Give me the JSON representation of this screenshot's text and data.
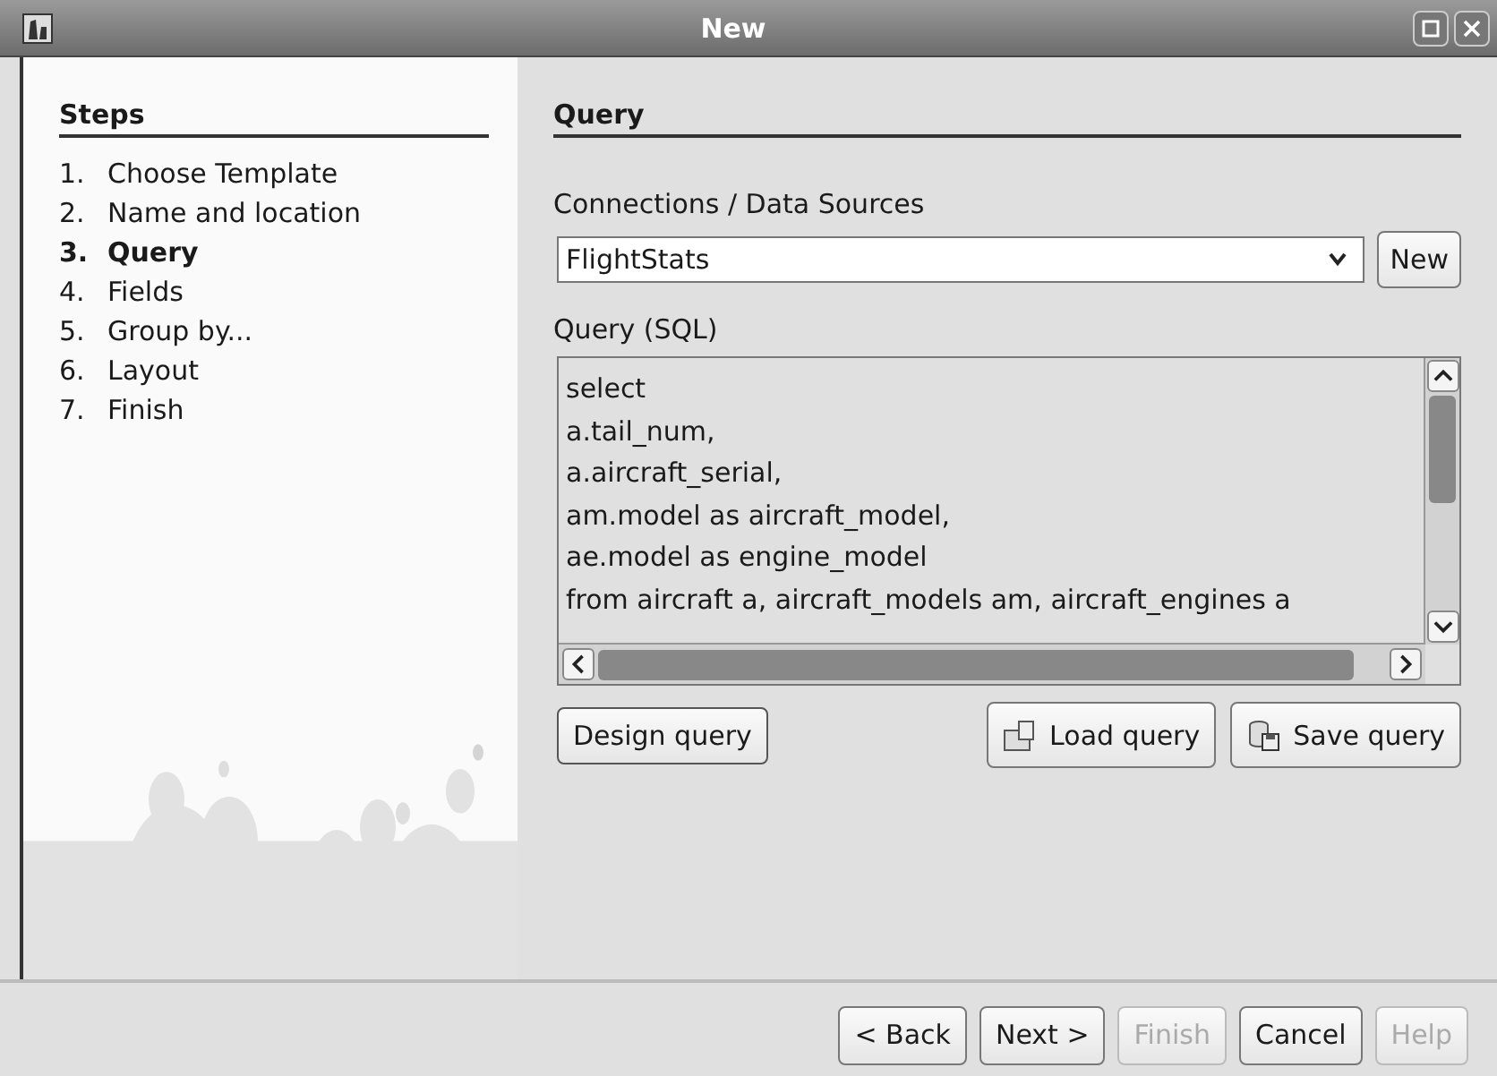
{
  "window": {
    "title": "New"
  },
  "steps": {
    "heading": "Steps",
    "items": [
      {
        "number": "1.",
        "label": "Choose Template",
        "selected": false
      },
      {
        "number": "2.",
        "label": "Name and location",
        "selected": false
      },
      {
        "number": "3.",
        "label": "Query",
        "selected": true
      },
      {
        "number": "4.",
        "label": "Fields",
        "selected": false
      },
      {
        "number": "5.",
        "label": "Group by...",
        "selected": false
      },
      {
        "number": "6.",
        "label": "Layout",
        "selected": false
      },
      {
        "number": "7.",
        "label": "Finish",
        "selected": false
      }
    ]
  },
  "page": {
    "heading": "Query",
    "connections_label": "Connections / Data Sources",
    "connection": {
      "value": "FlightStats"
    },
    "new_button": "New",
    "query_label": "Query (SQL)",
    "query_lines": [
      "select",
      "a.tail_num,",
      "a.aircraft_serial,",
      "am.model as aircraft_model,",
      "ae.model as engine_model",
      "from aircraft a, aircraft_models am, aircraft_engines a"
    ],
    "actions": [
      {
        "label": "Design query",
        "kind": "plain"
      },
      {
        "label": "Load query",
        "kind": "load"
      },
      {
        "label": "Save query",
        "kind": "save"
      }
    ]
  },
  "footer_buttons": [
    {
      "label": "< Back",
      "disabled": false
    },
    {
      "label": "Next >",
      "disabled": false
    },
    {
      "label": "Finish",
      "disabled": true
    },
    {
      "label": "Cancel",
      "disabled": false
    },
    {
      "label": "Help",
      "disabled": true
    }
  ]
}
